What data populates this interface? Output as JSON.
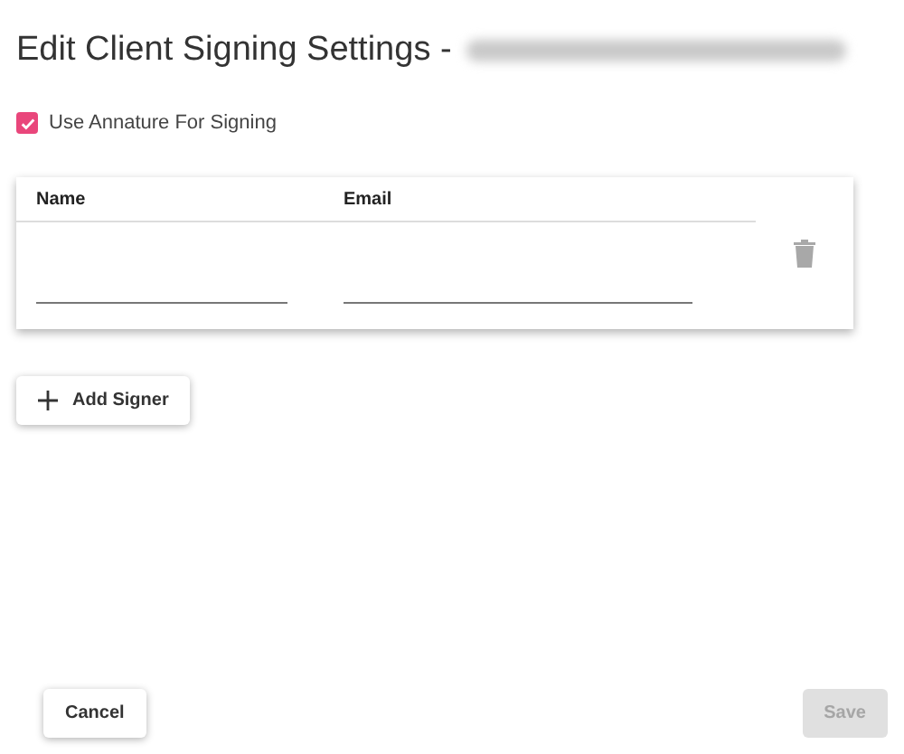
{
  "title": "Edit Client Signing Settings -",
  "title_redacted": true,
  "use_annature": {
    "label": "Use Annature For Signing",
    "checked": true
  },
  "signers": {
    "columns": [
      "Name",
      "Email"
    ],
    "rows": [
      {
        "name": "",
        "email": ""
      }
    ]
  },
  "add_button": "Add Signer",
  "buttons": [
    {
      "label": "Cancel",
      "disabled": false
    },
    {
      "label": "Save",
      "disabled": true
    }
  ]
}
